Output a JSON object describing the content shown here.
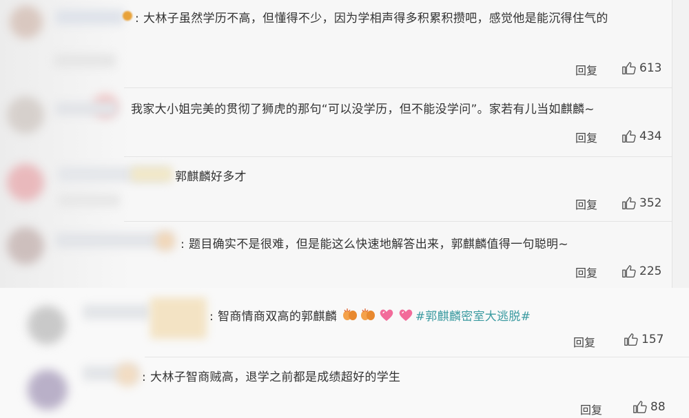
{
  "comments": [
    {
      "text": "大林子虽然学历不高，但懂得不少，因为学相声得多积累积攒吧，感觉他是能沉得住气的",
      "reply": "回复",
      "likes": "613"
    },
    {
      "text": "我家大小姐完美的贯彻了狮虎的那句“可以没学历，但不能没学问”。家若有儿当如麒麟~",
      "reply": "回复",
      "likes": "434"
    },
    {
      "text": "郭麒麟好多才",
      "reply": "回复",
      "likes": "352"
    },
    {
      "text": "题目确实不是很难，但是能这么快速地解答出来，郭麒麟值得一句聪明~",
      "reply": "回复",
      "likes": "225"
    },
    {
      "text": "智商情商双高的郭麒麟",
      "hashtag": "#郭麒麟密室大逃脱#",
      "reply": "回复",
      "likes": "157"
    },
    {
      "text": "大林子智商贼高，退学之前都是成绩超好的学生",
      "reply": "回复",
      "likes": "88"
    }
  ],
  "colon": ":",
  "icons": {
    "like": "thumbs-up-icon",
    "emoji_a": "clapping-hands-icon",
    "emoji_b": "pink-hearts-icon"
  },
  "colors": {
    "hashtag": "#3a9aa0",
    "text": "#333333",
    "background": "#f7f7f7"
  }
}
